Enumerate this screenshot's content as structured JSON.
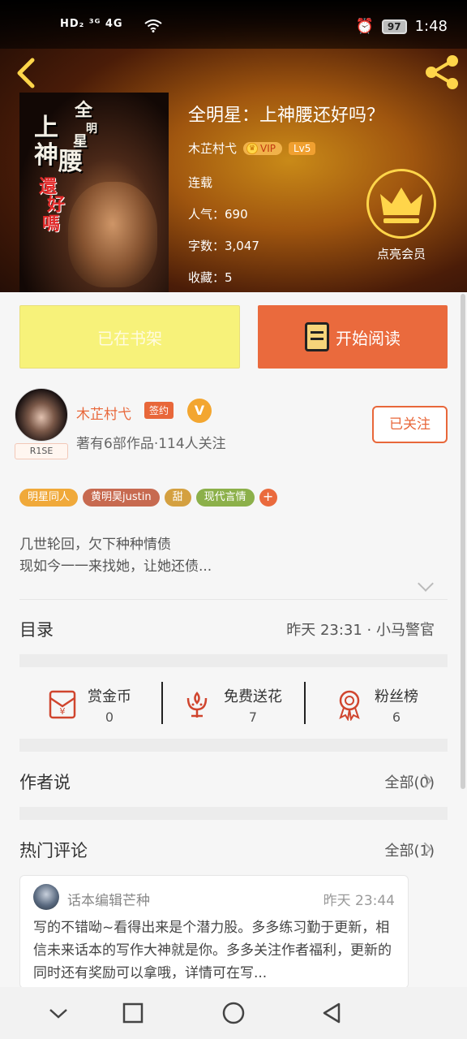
{
  "status_bar": {
    "network": "HD₂ ³ᴳ 4G",
    "battery": "97",
    "time": "1:48"
  },
  "book": {
    "cover_chars": [
      "上",
      "神",
      "腰",
      "全",
      "明",
      "星",
      "還",
      "好",
      "嗎"
    ],
    "title": "全明星：上神腰还好吗？",
    "author": "木芷村弋",
    "vip": "VIP",
    "level": "Lv5",
    "status": "连载",
    "popularity": "人气：690",
    "word_count": "字数：3,047",
    "favorites": "收藏：5",
    "member_label": "点亮会员"
  },
  "actions": {
    "shelf": "已在书架",
    "read": "开始阅读"
  },
  "author_card": {
    "name": "木芷村弋",
    "signed": "签约",
    "verified": "V",
    "badge": "R1SE",
    "stats": "著有6部作品·114人关注",
    "follow": "已关注"
  },
  "tags": [
    {
      "label": "明星同人",
      "color": "#f0a93a"
    },
    {
      "label": "黄明昊justin",
      "color": "#c76a50"
    },
    {
      "label": "甜",
      "color": "#d4a040"
    },
    {
      "label": "现代言情",
      "color": "#8cb04a"
    }
  ],
  "tag_more": "+",
  "intro": [
    "几世轮回，欠下种种情债",
    "现如今一一来找她，让她还债..."
  ],
  "catalog": {
    "title": "目录",
    "latest": "昨天 23:31 · 小马警官"
  },
  "stats": [
    {
      "label": "赏金币",
      "value": "0",
      "icon": "red-envelope-icon"
    },
    {
      "label": "免费送花",
      "value": "7",
      "icon": "flower-icon"
    },
    {
      "label": "粉丝榜",
      "value": "6",
      "icon": "medal-icon"
    }
  ],
  "author_says": {
    "title": "作者说",
    "all": "全部(0)"
  },
  "hot_comments": {
    "title": "热门评论",
    "all": "全部(1)"
  },
  "comment": {
    "user": "话本编辑芒种",
    "time": "昨天 23:44",
    "text": "写的不错呦~看得出来是个潜力股。多多练习勤于更新，相信未来话本的写作大神就是你。多多关注作者福利，更新的同时还有奖励可以拿哦，详情可在写..."
  },
  "colors": {
    "accent": "#ea6a3d",
    "shelf": "#f7f27a",
    "gold": "#ffd54a"
  }
}
